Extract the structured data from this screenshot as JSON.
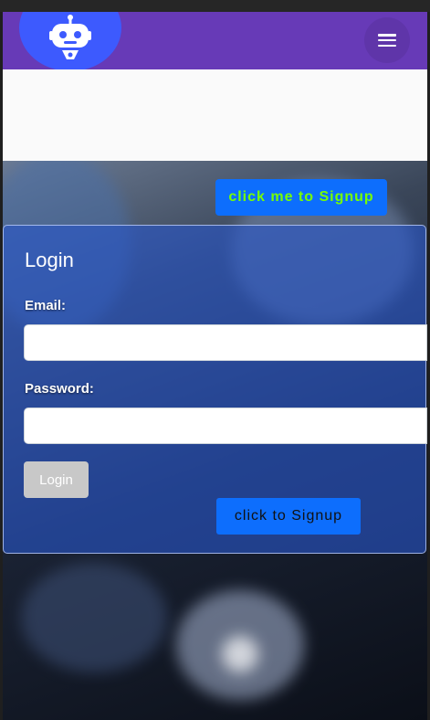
{
  "header": {
    "logo_icon": "robot-icon",
    "menu_icon": "hamburger-menu-icon"
  },
  "signup_top": {
    "label": "click me to Signup"
  },
  "login": {
    "title": "Login",
    "email_label": "Email:",
    "email_value": "",
    "password_label": "Password:",
    "password_value": "",
    "submit_label": "Login",
    "signup_label": "click to Signup"
  },
  "colors": {
    "header_bg": "#673ab7",
    "logo_bg": "#3d5afe",
    "signup_button_bg": "#0d6efd",
    "signup_top_text": "#76ff03",
    "login_button_bg": "#c8c8c8"
  }
}
